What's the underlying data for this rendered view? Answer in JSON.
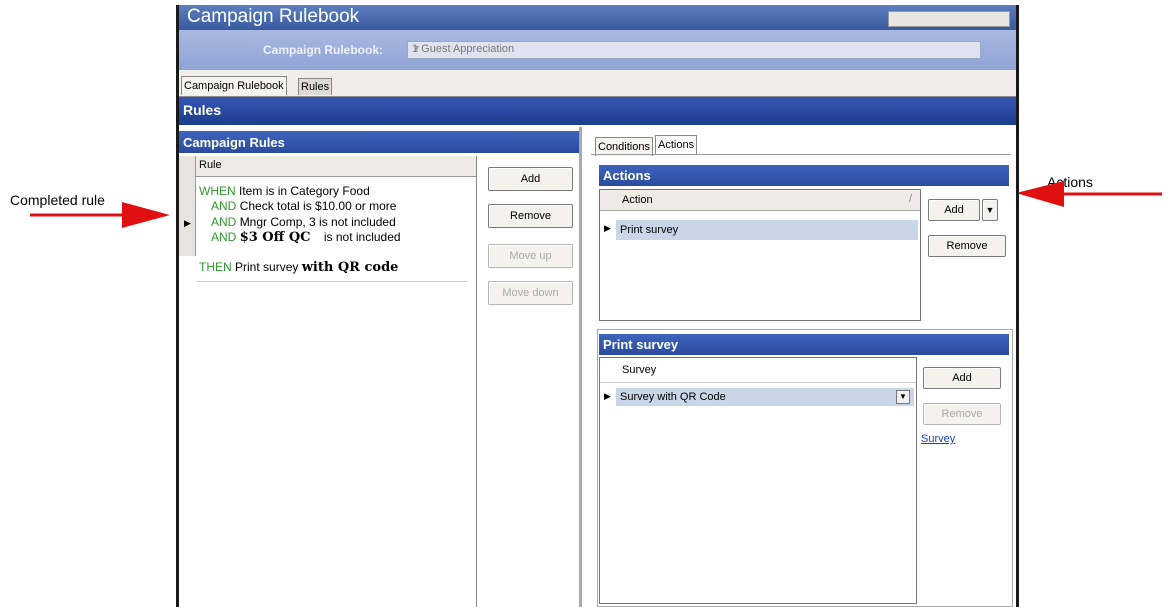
{
  "window": {
    "title": "Campaign Rulebook"
  },
  "rulebook": {
    "label": "Campaign Rulebook:",
    "selected": "1 Guest Appreciation"
  },
  "tabs": [
    {
      "label": "Campaign Rulebook"
    },
    {
      "label": "Rules"
    }
  ],
  "section": {
    "title": "Rules"
  },
  "campaign_rules": {
    "title": "Campaign Rules",
    "column_header": "Rule",
    "lines": [
      {
        "keyword": "WHEN",
        "text": "Item is in Category Food"
      },
      {
        "keyword": "AND",
        "text": "Check total is $10.00 or more"
      },
      {
        "keyword": "AND",
        "text": "Mngr Comp, 3 is not included"
      },
      {
        "keyword": "AND",
        "bold": "$3 Off QC",
        "text": "is not included"
      },
      {
        "keyword": "THEN",
        "text": "Print survey",
        "bold": "with QR code"
      }
    ],
    "buttons": {
      "add": "Add",
      "remove": "Remove",
      "move_up": "Move up",
      "move_down": "Move down"
    }
  },
  "right_tabs": [
    {
      "label": "Conditions"
    },
    {
      "label": "Actions"
    }
  ],
  "actions_panel": {
    "title": "Actions",
    "column_header": "Action",
    "row": "Print survey",
    "buttons": {
      "add": "Add",
      "remove": "Remove"
    }
  },
  "print_survey_panel": {
    "title": "Print survey",
    "column_header": "Survey",
    "row": "Survey with QR Code",
    "buttons": {
      "add": "Add",
      "remove": "Remove"
    },
    "link": "Survey"
  },
  "annotations": {
    "left": "Completed rule",
    "right": "Actions",
    "arrow_color": "#e01010"
  }
}
